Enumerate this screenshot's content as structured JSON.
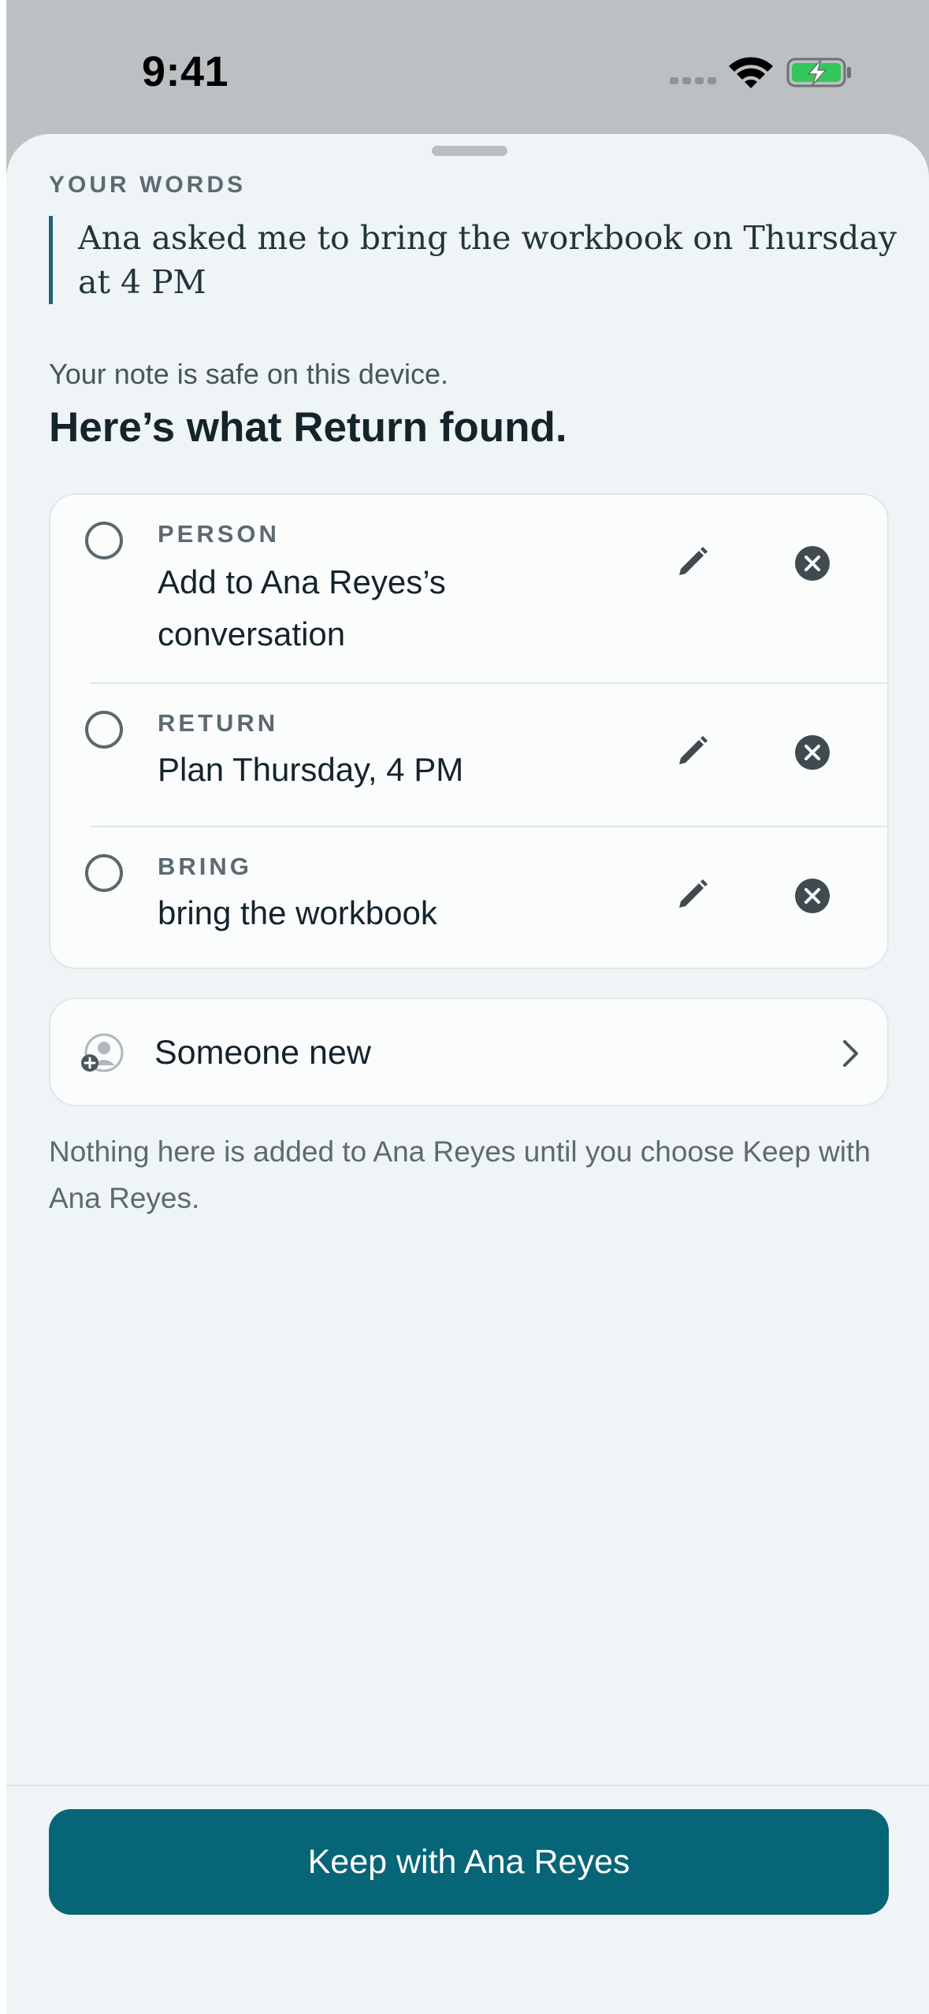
{
  "status_bar": {
    "time": "9:41",
    "icons": [
      "cellular-signal-icon",
      "wifi-icon",
      "battery-charging-icon"
    ]
  },
  "sheet": {
    "your_words_label": "YOUR WORDS",
    "quote": "Ana asked me to bring the workbook on Thursday at 4 PM",
    "safe_note": "Your note is safe on this device.",
    "title": "Here’s what Return found.",
    "items": [
      {
        "kind": "PERSON",
        "text": "Add to Ana Reyes’s conversation",
        "selected": false
      },
      {
        "kind": "RETURN",
        "text": "Plan Thursday, 4 PM",
        "selected": false
      },
      {
        "kind": "BRING",
        "text": "bring the workbook",
        "selected": false
      }
    ],
    "someone_new_label": "Someone new",
    "disclaimer": "Nothing here is added to Ana Reyes until you choose Keep with Ana Reyes.",
    "keep_button_label": "Keep with Ana Reyes"
  },
  "colors": {
    "accent": "#076578",
    "quote_bar": "#1e6473",
    "sheet_bg": "#eff5f6",
    "dim_bg": "#bcc0c2"
  }
}
